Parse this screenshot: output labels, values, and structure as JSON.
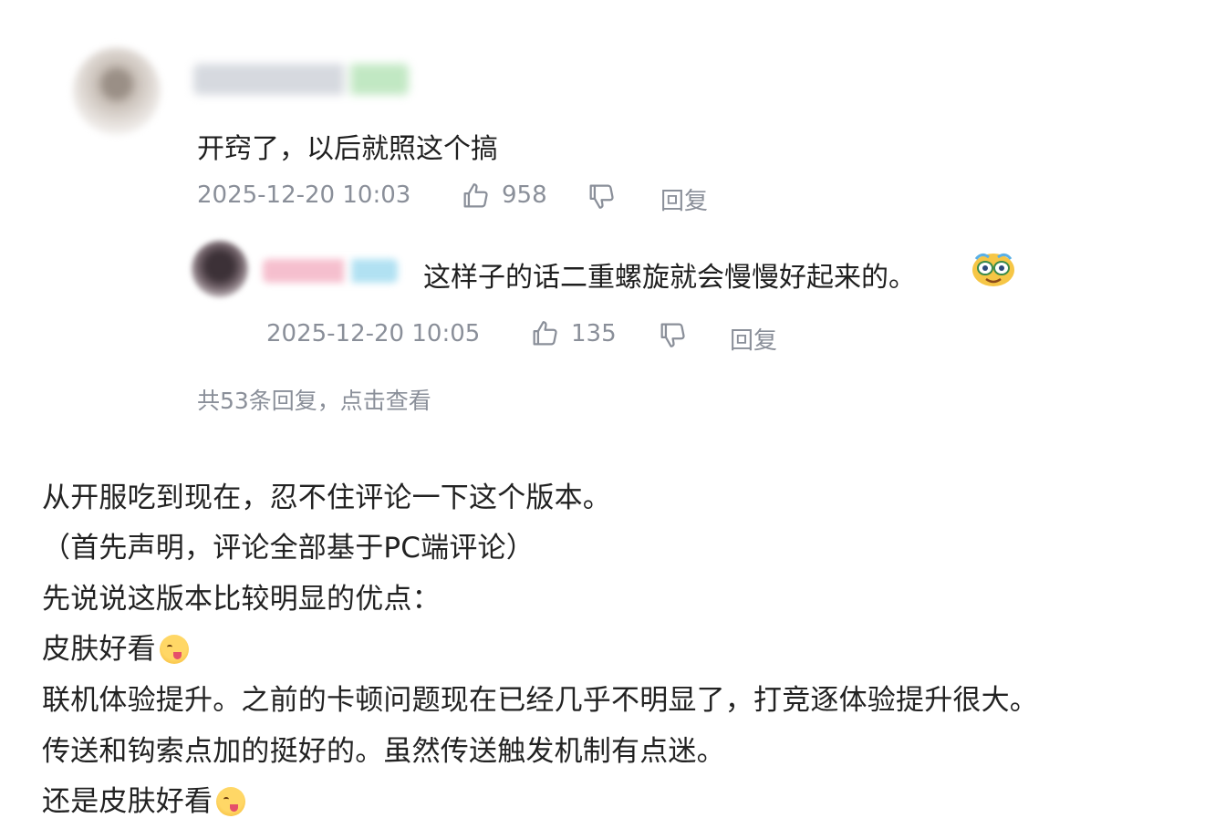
{
  "main_comment": {
    "text": "开窍了，以后就照这个搞",
    "timestamp": "2025-12-20 10:03",
    "likes": "958",
    "reply_label": "回复"
  },
  "reply_comment": {
    "text": "这样子的话二重螺旋就会慢慢好起来的。",
    "timestamp": "2025-12-20 10:05",
    "likes": "135",
    "reply_label": "回复"
  },
  "replies_summary": "共53条回复，点击查看",
  "article": {
    "lines": [
      "从开服吃到现在，忍不住评论一下这个版本。",
      "（首先声明，评论全部基于PC端评论）",
      "先说说这版本比较明显的优点：",
      "皮肤好看",
      "联机体验提升。之前的卡顿问题现在已经几乎不明显了，打竞逐体验提升很大。",
      "传送和钩索点加的挺好的。虽然传送触发机制有点迷。",
      "还是皮肤好看"
    ]
  },
  "icons": {
    "like": "thumbs-up-icon",
    "dislike": "thumbs-down-icon",
    "sticker": "crying-laughing-sticker-icon",
    "emoji": "yum-face-emoji-icon"
  },
  "colors": {
    "text": "#1f1f1f",
    "meta": "#8a8f99",
    "background": "#ffffff"
  }
}
